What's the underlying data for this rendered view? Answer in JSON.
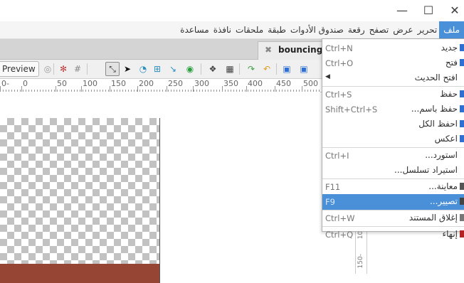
{
  "window": {
    "minimize_glyph": "—",
    "maximize_glyph": "☐",
    "close_glyph": "✕"
  },
  "menubar": {
    "items": [
      "ملف",
      "تحرير",
      "عرض",
      "تصفح",
      "رقعة",
      "صندوق الأدوات",
      "طبقة",
      "ملحقات",
      "نافذة",
      "مساعدة"
    ]
  },
  "tab": {
    "close_glyph": "✖",
    "label": "bouncing"
  },
  "toolbar": {
    "preview_label": "Preview"
  },
  "ruler": {
    "labels": [
      "0-",
      "0",
      "50",
      "100",
      "150",
      "200",
      "250",
      "300",
      "350",
      "400",
      "450",
      "500"
    ]
  },
  "vruler": {
    "labels": [
      "100",
      "150-"
    ]
  },
  "file_menu": {
    "items": [
      {
        "label": "جديد",
        "shortcut": "Ctrl+N",
        "icon": "new-document-icon",
        "color": "#2f6fd1"
      },
      {
        "label": "فتح",
        "shortcut": "Ctrl+O",
        "icon": "open-folder-icon",
        "color": "#2f6fd1"
      },
      {
        "label": "افتح الحديث",
        "shortcut": "",
        "submenu": true
      },
      {
        "label": "حفظ",
        "shortcut": "Ctrl+S",
        "icon": "save-icon",
        "color": "#2f6fd1"
      },
      {
        "label": "حفظ باسم...",
        "shortcut": "Shift+Ctrl+S",
        "icon": "save-as-icon",
        "color": "#2f6fd1"
      },
      {
        "label": "احفظ الكل",
        "shortcut": "",
        "icon": "save-all-icon",
        "color": "#2f6fd1"
      },
      {
        "label": "اعكس",
        "shortcut": "",
        "icon": "revert-icon",
        "color": "#2f6fd1"
      },
      {
        "label": "استورد...",
        "shortcut": "Ctrl+I",
        "icon": ""
      },
      {
        "label": "استيراد تسلسل...",
        "shortcut": "",
        "icon": ""
      },
      {
        "label": "معاينة...",
        "shortcut": "F11",
        "icon": "preview-icon",
        "color": "#555555"
      },
      {
        "label": "تصيير...",
        "shortcut": "F9",
        "icon": "render-icon",
        "color": "#444444"
      },
      {
        "label": "إغلاق المستند",
        "shortcut": "Ctrl+W",
        "icon": "close-doc-icon",
        "color": "#777777"
      },
      {
        "label": "إنهاء",
        "shortcut": "Ctrl+Q",
        "icon": "quit-icon",
        "color": "#b22222"
      }
    ],
    "highlighted_index": 10,
    "separators_after": [
      2,
      6,
      8,
      10,
      11
    ]
  },
  "colors": {
    "accent": "#4a90d9",
    "canvas_ground": "#964433"
  }
}
